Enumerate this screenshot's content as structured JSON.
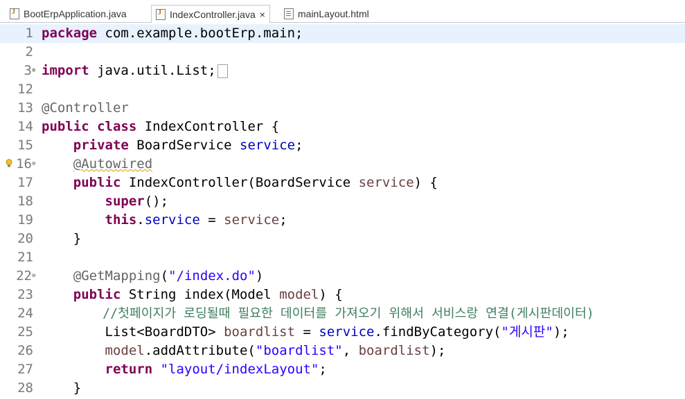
{
  "tabs": [
    {
      "label": "BootErpApplication.java",
      "icon": "java-file-icon",
      "active": false
    },
    {
      "label": "IndexController.java",
      "icon": "java-file-icon",
      "active": true,
      "close": "×"
    },
    {
      "label": "mainLayout.html",
      "icon": "html-file-icon",
      "active": false
    }
  ],
  "lines": {
    "n1": "1",
    "n2": "2",
    "n3": "3",
    "n12": "12",
    "n13": "13",
    "n14": "14",
    "n15": "15",
    "n16": "16",
    "n17": "17",
    "n18": "18",
    "n19": "19",
    "n20": "20",
    "n21": "21",
    "n22": "22",
    "n23": "23",
    "n24": "24",
    "n25": "25",
    "n26": "26",
    "n27": "27",
    "n28": "28"
  },
  "code": {
    "l1_kw": "package",
    "l1_rest": " com.example.bootErp.main;",
    "l3_kw": "import",
    "l3_rest": " java.util.List;",
    "l13_ann": "@Controller",
    "l14_kw1": "public",
    "l14_kw2": "class",
    "l14_rest": " IndexController {",
    "l15_kw": "private",
    "l15_type": " BoardService ",
    "l15_fld": "service",
    "l15_end": ";",
    "l16_ann": "@Autowired",
    "l17_kw": "public",
    "l17_mid": " IndexController(BoardService ",
    "l17_par": "service",
    "l17_end": ") {",
    "l18_kw": "super",
    "l18_end": "();",
    "l19_kw": "this",
    "l19_dot": ".",
    "l19_fld": "service",
    "l19_eq": " = ",
    "l19_par": "service",
    "l19_end": ";",
    "l20": "}",
    "l22_ann": "@GetMapping",
    "l22_open": "(",
    "l22_str": "\"/index.do\"",
    "l22_close": ")",
    "l23_kw": "public",
    "l23_mid": " String index(Model ",
    "l23_par": "model",
    "l23_end": ") {",
    "l24_cmt": "//첫페이지가 로딩될때 필요한 데이터를 가져오기 위해서 서비스랑 연결(게시판데이터)",
    "l25_a": "List<BoardDTO> ",
    "l25_par": "boardlist",
    "l25_eq": " = ",
    "l25_fld": "service",
    "l25_call": ".findByCategory(",
    "l25_str": "\"게시판\"",
    "l25_end": ");",
    "l26_par": "model",
    "l26_call": ".addAttribute(",
    "l26_str": "\"boardlist\"",
    "l26_sep": ", ",
    "l26_par2": "boardlist",
    "l26_end": ");",
    "l27_kw": "return",
    "l27_sp": " ",
    "l27_str": "\"layout/indexLayout\"",
    "l27_end": ";",
    "l28": "}"
  },
  "colors": {
    "keyword": "#7f0055",
    "annotation": "#646464",
    "field": "#0000c0",
    "string": "#2a00ff",
    "comment": "#3f7f5f",
    "current_line": "#e8f2fe"
  }
}
